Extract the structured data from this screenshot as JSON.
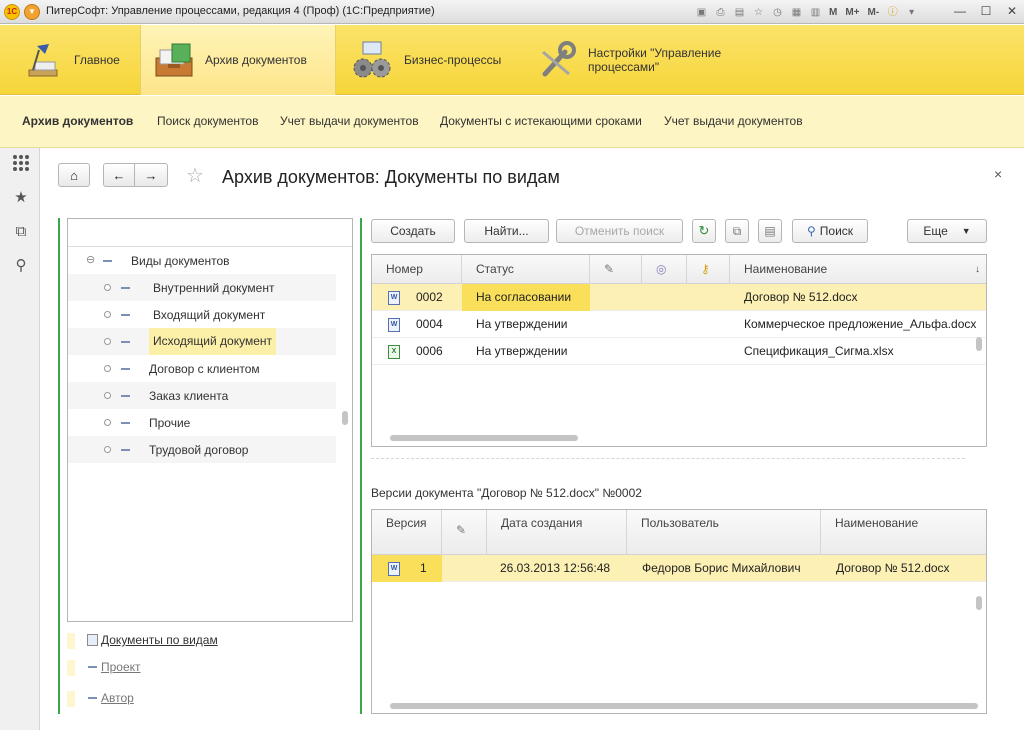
{
  "window": {
    "title": "ПитерСофт: Управление процессами, редакция 4 (Проф)  (1С:Предприятие)",
    "logo_text": "1С",
    "toolbar_m": [
      "M",
      "M+",
      "M-"
    ]
  },
  "sections": [
    {
      "label": "Главное",
      "icon": "desk-lamp-icon"
    },
    {
      "label": "Архив документов",
      "icon": "archive-box-icon",
      "active": true
    },
    {
      "label": "Бизнес-процессы",
      "icon": "gears-icon"
    },
    {
      "label_lines": [
        "Настройки \"Управление",
        "процессами\""
      ],
      "icon": "wrench-icon"
    }
  ],
  "functions": [
    "Архив документов",
    "Поиск документов",
    "Учет выдачи документов",
    "Документы с истекающими сроками",
    "Учет выдачи документов"
  ],
  "form": {
    "title": "Архив документов: Документы по видам",
    "close": "×"
  },
  "tree": {
    "root": "Виды документов",
    "items": [
      "Внутренний документ",
      "Входящий документ",
      "Исходящий документ",
      "Договор с клиентом",
      "Заказ клиента",
      "Прочие",
      "Трудовой договор"
    ],
    "selected": "Исходящий документ"
  },
  "favorites": {
    "docs_by_type": "Документы по видам",
    "project": "Проект",
    "author": "Автор"
  },
  "commands": {
    "create": "Создать",
    "find": "Найти...",
    "cancel_search": "Отменить поиск",
    "search": "Поиск",
    "more": "Еще"
  },
  "documents": {
    "columns": {
      "number": "Номер",
      "status": "Статус",
      "name": "Наименование"
    },
    "rows": [
      {
        "number": "0002",
        "status": "На согласовании",
        "name": "Договор № 512.docx",
        "type": "W",
        "selected": true
      },
      {
        "number": "0004",
        "status": "На утверждении",
        "name": "Коммерческое предложение_Альфа.docx",
        "type": "W"
      },
      {
        "number": "0006",
        "status": "На утверждении",
        "name": "Спецификация_Сигма.xlsx",
        "type": "X"
      }
    ]
  },
  "versions": {
    "label": "Версии документа \"Договор № 512.docx\" №0002",
    "columns": {
      "version": "Версия",
      "created": "Дата создания",
      "user": "Пользователь",
      "name": "Наименование"
    },
    "rows": [
      {
        "version": "1",
        "created": "26.03.2013 12:56:48",
        "user": "Федоров Борис Михайлович",
        "name": "Договор № 512.docx",
        "type": "W"
      }
    ]
  },
  "colors": {
    "sections_bg": "#f6d53a",
    "functions_bg": "#fdf5c4",
    "selection": "#fcf0b4",
    "accent_green": "#3aa74d"
  }
}
